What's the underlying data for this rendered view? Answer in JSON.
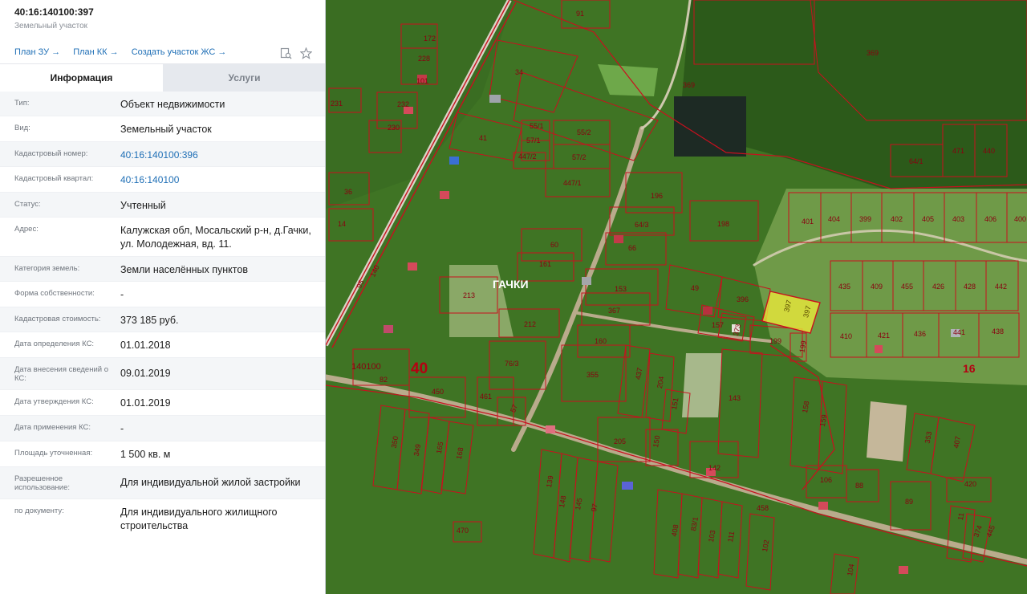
{
  "panel": {
    "title": "40:16:140100:397",
    "subtitle": "Земельный участок",
    "links": [
      "План ЗУ →",
      "План КК →",
      "Создать участок ЖС →"
    ],
    "icons": [
      "search-doc-icon",
      "star-icon"
    ],
    "tabs": [
      "Информация",
      "Услуги"
    ],
    "rows": [
      {
        "label": "Тип:",
        "value": "Объект недвижимости",
        "link": false
      },
      {
        "label": "Вид:",
        "value": "Земельный участок",
        "link": false
      },
      {
        "label": "Кадастровый номер:",
        "value": "40:16:140100:396",
        "link": true
      },
      {
        "label": "Кадастровый квартал:",
        "value": "40:16:140100",
        "link": true
      },
      {
        "label": "Статус:",
        "value": "Учтенный",
        "link": false
      },
      {
        "label": "Адрес:",
        "value": "Калужская обл, Мосальский р-н, д.Гачки, ул. Молодежная, вд. 11.",
        "link": false
      },
      {
        "label": "Категория земель:",
        "value": "Земли населённых пунктов",
        "link": false
      },
      {
        "label": "Форма собственности:",
        "value": "-",
        "link": false
      },
      {
        "label": "Кадастровая стоимость:",
        "value": "373 185 руб.",
        "link": false
      },
      {
        "label": "Дата определения КС:",
        "value": "01.01.2018",
        "link": false
      },
      {
        "label": "Дата внесения сведений о КС:",
        "value": "09.01.2019",
        "link": false
      },
      {
        "label": "Дата утверждения КС:",
        "value": "01.01.2019",
        "link": false
      },
      {
        "label": "Дата применения КС:",
        "value": "-",
        "link": false
      },
      {
        "label": "Площадь уточненная:",
        "value": "1 500 кв. м",
        "link": false
      },
      {
        "label": "Разрешенное использование:",
        "value": "Для индивидуальной жилой застройки",
        "link": false
      },
      {
        "label": "по документу:",
        "value": "Для индивидуального жилищного строительства",
        "link": false
      }
    ]
  },
  "map": {
    "village": "ГАЧКИ",
    "quarter_labels": [
      "40",
      "16"
    ],
    "quarter_code": "140100",
    "selected_parcel": "397",
    "colors": {
      "boundary": "#c8101e",
      "selected_fill": "#f2ee3a",
      "label": "#8a0010"
    },
    "parcels": [
      "91",
      "369",
      "172",
      "228",
      "34",
      "101",
      "232",
      "369",
      "231",
      "230",
      "55/1",
      "57/1",
      "447/2",
      "55/2",
      "57/2",
      "41",
      "64/1",
      "471",
      "440",
      "447/1",
      "196",
      "36",
      "198",
      "401",
      "404",
      "399",
      "402",
      "405",
      "403",
      "406",
      "400",
      "14",
      "64/3",
      "60",
      "66",
      "161",
      "435",
      "409",
      "455",
      "426",
      "428",
      "442",
      "213",
      "153",
      "49",
      "396",
      "367",
      "157",
      "373",
      "212",
      "410",
      "421",
      "436",
      "441",
      "438",
      "160",
      "199",
      "199",
      "140100",
      "82",
      "76/3",
      "355",
      "437",
      "204",
      "143",
      "450",
      "461",
      "57",
      "151",
      "158",
      "159",
      "350",
      "349",
      "165",
      "168",
      "205",
      "150",
      "142",
      "353",
      "407",
      "106",
      "88",
      "139",
      "148",
      "145",
      "97",
      "408",
      "83/1",
      "103",
      "111",
      "102",
      "458",
      "89",
      "420",
      "11",
      "374",
      "445",
      "470",
      "104",
      "95",
      "140",
      "397"
    ]
  }
}
